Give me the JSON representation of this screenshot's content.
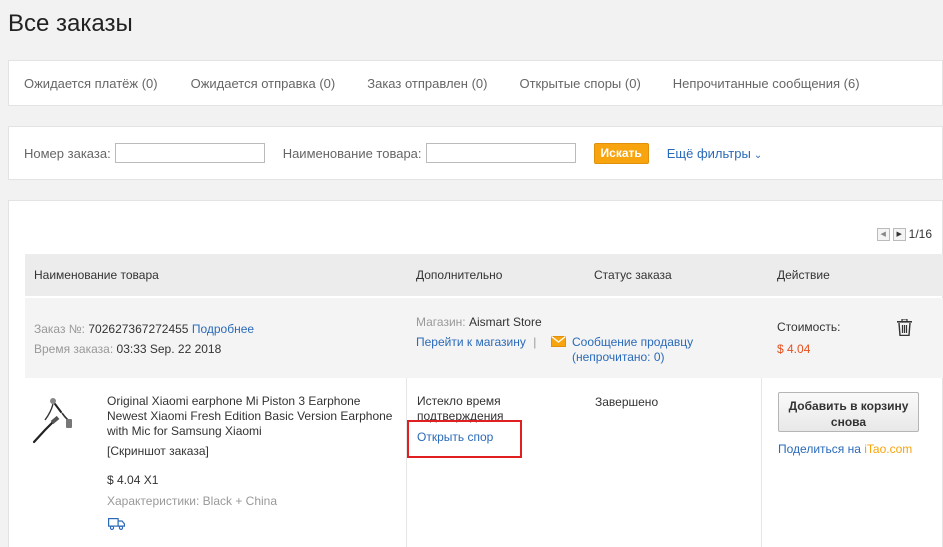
{
  "page": {
    "title": "Все заказы"
  },
  "tabs": [
    {
      "label": "Ожидается платёж (0)"
    },
    {
      "label": "Ожидается отправка (0)"
    },
    {
      "label": "Заказ отправлен (0)"
    },
    {
      "label": "Открытые споры (0)"
    },
    {
      "label": "Непрочитанные сообщения (6)"
    }
  ],
  "filters": {
    "order_number_label": "Номер заказа:",
    "order_number_value": "",
    "product_name_label": "Наименование товара:",
    "product_name_value": "",
    "search_label": "Искать",
    "more_filters_label": "Ещё фильтры"
  },
  "pagination": {
    "text": "1/16"
  },
  "table": {
    "headers": [
      "Наименование товара",
      "Дополнительно",
      "Статус заказа",
      "Действие"
    ]
  },
  "order": {
    "number_label": "Заказ №:",
    "number": "702627367272455",
    "details_link": "Подробнее",
    "time_label": "Время заказа:",
    "time": "03:33 Sep. 22 2018",
    "store_label": "Магазин:",
    "store_name": "Aismart Store",
    "go_to_store": "Перейти к магазину",
    "separator": "|",
    "message_seller": "Сообщение продавцу",
    "unread_text": "(непрочитано: ",
    "unread_count": "0",
    "unread_close": ")",
    "cost_label": "Стоимость:",
    "cost": "$ 4.04",
    "item": {
      "title_line1": "Original Xiaomi earphone Mi Piston 3 Earphone",
      "title_line2": "Newest Xiaomi Fresh Edition Basic Version Earphone",
      "title_line3": "with Mic for Samsung Xiaomi",
      "snapshot": "[Скриншот заказа]",
      "price_qty": "$ 4.04 X1",
      "specs": "Характеристики: Black + China"
    },
    "extra_line1": "Истекло время",
    "extra_line2": "подтверждения",
    "open_dispute": "Открыть спор",
    "status": "Завершено",
    "add_to_cart_line1": "Добавить в корзину",
    "add_to_cart_line2": "снова",
    "share_text": "Поделиться на ",
    "share_brand": "iTao.com"
  },
  "colors": {
    "accent": "#f7a40e",
    "link": "#2a6ab9",
    "price": "#e4501f",
    "highlight": "#e02020"
  },
  "icons": [
    "chevron-down-icon",
    "prev-page-icon",
    "next-page-icon",
    "envelope-icon",
    "trash-icon",
    "shipping-truck-icon",
    "earphone-product-image"
  ]
}
